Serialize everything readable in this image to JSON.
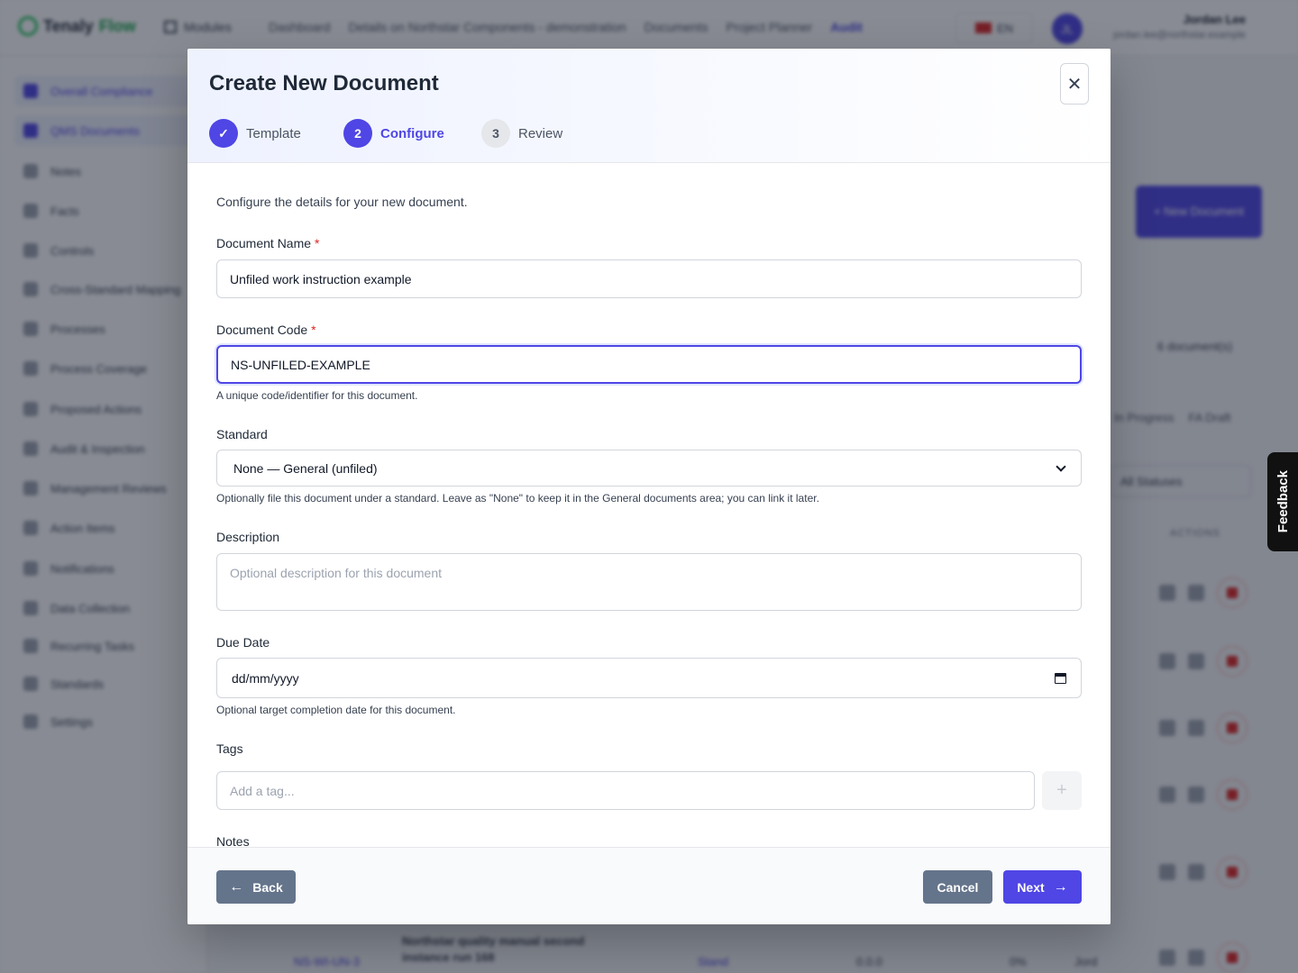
{
  "background": {
    "logo": {
      "part1": "Tenaly",
      "part2": "Flow"
    },
    "modules_label": "Modules",
    "nav": [
      "Dashboard",
      "Details on Northstar Components - demonstration",
      "Documents",
      "Project Planner",
      "Audit"
    ],
    "language": "EN",
    "user": {
      "name": "Jordan Lee",
      "email": "jordan.lee@northstar.example",
      "initials": "JL"
    },
    "sidebar": [
      "Overall Compliance",
      "QMS Documents",
      "Notes",
      "Facts",
      "Controls",
      "Cross-Standard Mapping",
      "Processes",
      "Process Coverage",
      "Proposed Actions",
      "Audit & Inspection",
      "Management Reviews",
      "Action Items",
      "Notifications",
      "Data Collection",
      "Recurring Tasks",
      "Standards",
      "Settings"
    ],
    "new_document_button": "+ New Document",
    "document_count": "6 document(s)",
    "filters": [
      "In Progress",
      "FA Draft"
    ],
    "status_filter": "All Statuses",
    "actions_header": "ACTIONS",
    "bottom_row": {
      "code": "NS-WI-UN-3",
      "title": "Northstar quality manual second instance run 168",
      "standard": "Stand",
      "version": "0.0.0",
      "progress": "0%",
      "owner": "Jord"
    }
  },
  "feedback": "Feedback",
  "modal": {
    "title": "Create New Document",
    "close_symbol": "✕",
    "steps": [
      {
        "number": "✓",
        "label": "Template",
        "state": "done"
      },
      {
        "number": "2",
        "label": "Configure",
        "state": "active"
      },
      {
        "number": "3",
        "label": "Review",
        "state": "todo"
      }
    ],
    "intro": "Configure the details for your new document.",
    "fields": {
      "name": {
        "label": "Document Name",
        "required": "*",
        "value": "Unfiled work instruction example"
      },
      "code": {
        "label": "Document Code",
        "required": "*",
        "value": "NS-UNFILED-EXAMPLE",
        "help": "A unique code/identifier for this document."
      },
      "standard": {
        "label": "Standard",
        "selected": "None — General (unfiled)",
        "help": "Optionally file this document under a standard. Leave as \"None\" to keep it in the General documents area; you can link it later."
      },
      "description": {
        "label": "Description",
        "placeholder": "Optional description for this document"
      },
      "due_date": {
        "label": "Due Date",
        "value": "dd/mm/yyyy",
        "help": "Optional target completion date for this document."
      },
      "tags": {
        "label": "Tags",
        "placeholder": "Add a tag...",
        "add_symbol": "+"
      },
      "notes": {
        "label": "Notes"
      }
    },
    "footer": {
      "back": "Back",
      "cancel": "Cancel",
      "next": "Next",
      "back_arrow": "←",
      "next_arrow": "→"
    }
  },
  "colors": {
    "primary": "#4f46e5",
    "secondary_button": "#64748b",
    "required": "#dc2626"
  }
}
